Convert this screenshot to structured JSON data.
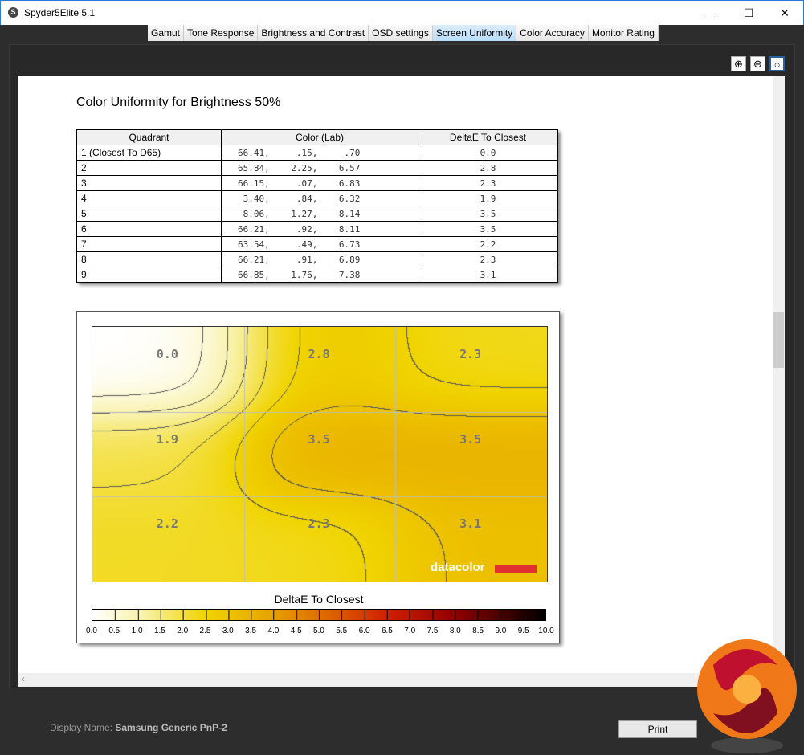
{
  "window": {
    "title": "Spyder5Elite 5.1",
    "minimize": "—",
    "maximize": "☐",
    "close": "✕"
  },
  "tabs": [
    {
      "label": "Gamut"
    },
    {
      "label": "Tone Response"
    },
    {
      "label": "Brightness and Contrast"
    },
    {
      "label": "OSD settings"
    },
    {
      "label": "Screen Uniformity",
      "active": true
    },
    {
      "label": "Color Accuracy"
    },
    {
      "label": "Monitor Rating"
    }
  ],
  "zoom_controls": {
    "zoom_in": "zoom-in-icon",
    "zoom_out": "zoom-out-icon",
    "zoom_fit": "zoom-fit-icon"
  },
  "report": {
    "heading": "Color Uniformity for Brightness 50%",
    "table": {
      "headers": [
        "Quadrant",
        "Color (Lab)",
        "DeltaE To Closest"
      ],
      "rows": [
        [
          "1 (Closest To D65)",
          "66.41,     .15,     .70",
          "0.0"
        ],
        [
          "2",
          "65.84,    2.25,    6.57",
          "2.8"
        ],
        [
          "3",
          "66.15,     .07,    6.83",
          "2.3"
        ],
        [
          "4",
          " 3.40,     .84,    6.32",
          "1.9"
        ],
        [
          "5",
          " 8.06,    1.27,    8.14",
          "3.5"
        ],
        [
          "6",
          "66.21,     .92,    8.11",
          "3.5"
        ],
        [
          "7",
          "63.54,     .49,    6.73",
          "2.2"
        ],
        [
          "8",
          "66.21,     .91,    6.89",
          "2.3"
        ],
        [
          "9",
          "66.85,    1.76,    7.38",
          "3.1"
        ]
      ]
    }
  },
  "chart_data": {
    "type": "heatmap",
    "grid": [
      [
        "0.0",
        "2.8",
        "2.3"
      ],
      [
        "1.9",
        "3.5",
        "3.5"
      ],
      [
        "2.2",
        "2.3",
        "3.1"
      ]
    ],
    "values": [
      [
        0.0,
        2.8,
        2.3
      ],
      [
        1.9,
        3.5,
        3.5
      ],
      [
        2.2,
        2.3,
        3.1
      ]
    ],
    "contours": true,
    "colorbar": {
      "title": "DeltaE To Closest",
      "range": [
        0,
        10
      ],
      "ticks": [
        "0.0",
        "0.5",
        "1.0",
        "1.5",
        "2.0",
        "2.5",
        "3.0",
        "3.5",
        "4.0",
        "4.5",
        "5.0",
        "5.5",
        "6.0",
        "6.5",
        "7.0",
        "7.5",
        "8.0",
        "8.5",
        "9.0",
        "9.5",
        "10.0"
      ],
      "colors": [
        "#ffffff",
        "#f8f0a0",
        "#f0d400",
        "#e8a800",
        "#e07000",
        "#d02000",
        "#900000",
        "#000000"
      ]
    },
    "watermark": "datacolor"
  },
  "footer": {
    "display_label": "Display Name:",
    "display_value": "Samsung Generic PnP-2",
    "print": "Print"
  }
}
